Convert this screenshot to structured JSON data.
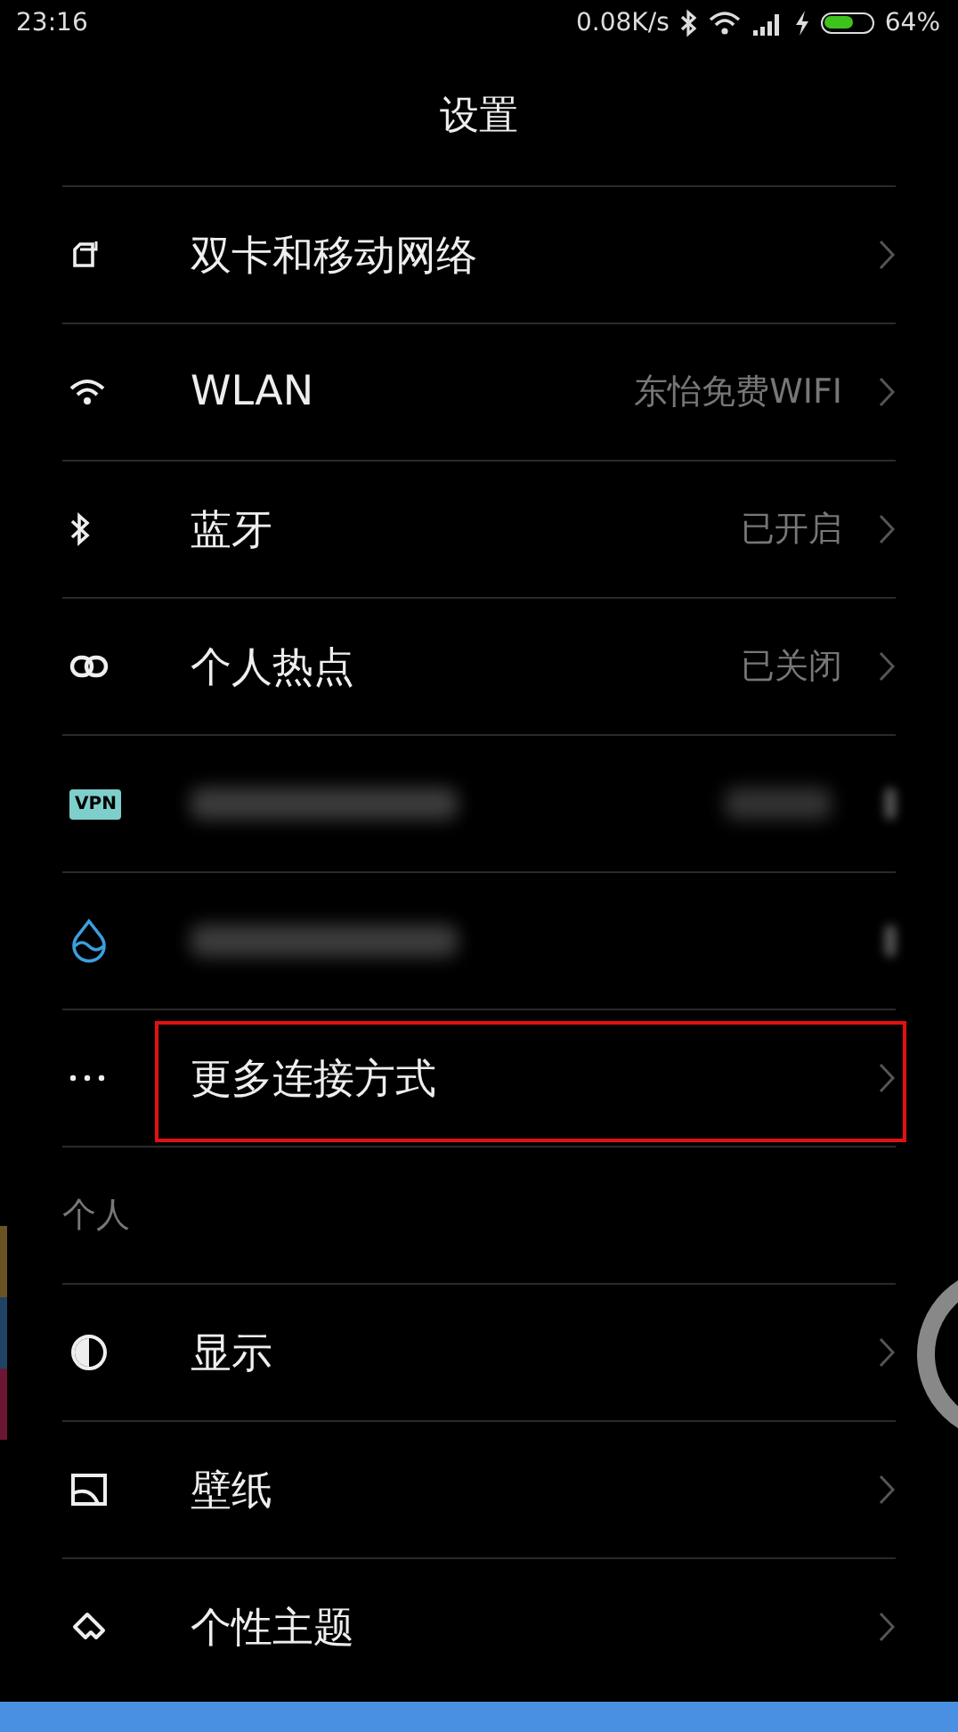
{
  "status_bar": {
    "time": "23:16",
    "speed": "0.08K/s",
    "battery": {
      "level": 0.64
    },
    "battery_text": "64%"
  },
  "title": "设置",
  "sections": [
    {
      "rows": [
        {
          "kind": "item",
          "label": "双卡和移动网络",
          "highlighted": false
        },
        {
          "kind": "item",
          "label": "WLAN",
          "value": "东怡免费WIFI",
          "highlighted": false
        },
        {
          "kind": "item",
          "label": "蓝牙",
          "value": "已开启",
          "highlighted": false
        },
        {
          "kind": "item",
          "label": "个人热点",
          "value": "已关闭",
          "highlighted": false
        },
        {
          "kind": "blurred",
          "icon_text": "VPN",
          "value_hidden": true,
          "highlighted": false
        },
        {
          "kind": "blurred",
          "value_hidden": false,
          "highlighted": false
        },
        {
          "kind": "item",
          "label": "更多连接方式",
          "highlighted": true
        }
      ]
    },
    {
      "header": "个人",
      "rows": [
        {
          "kind": "item",
          "label": "显示",
          "highlighted": false
        },
        {
          "kind": "item",
          "label": "壁纸",
          "highlighted": false
        },
        {
          "kind": "item",
          "label": "个性主题",
          "highlighted": false
        }
      ]
    }
  ]
}
